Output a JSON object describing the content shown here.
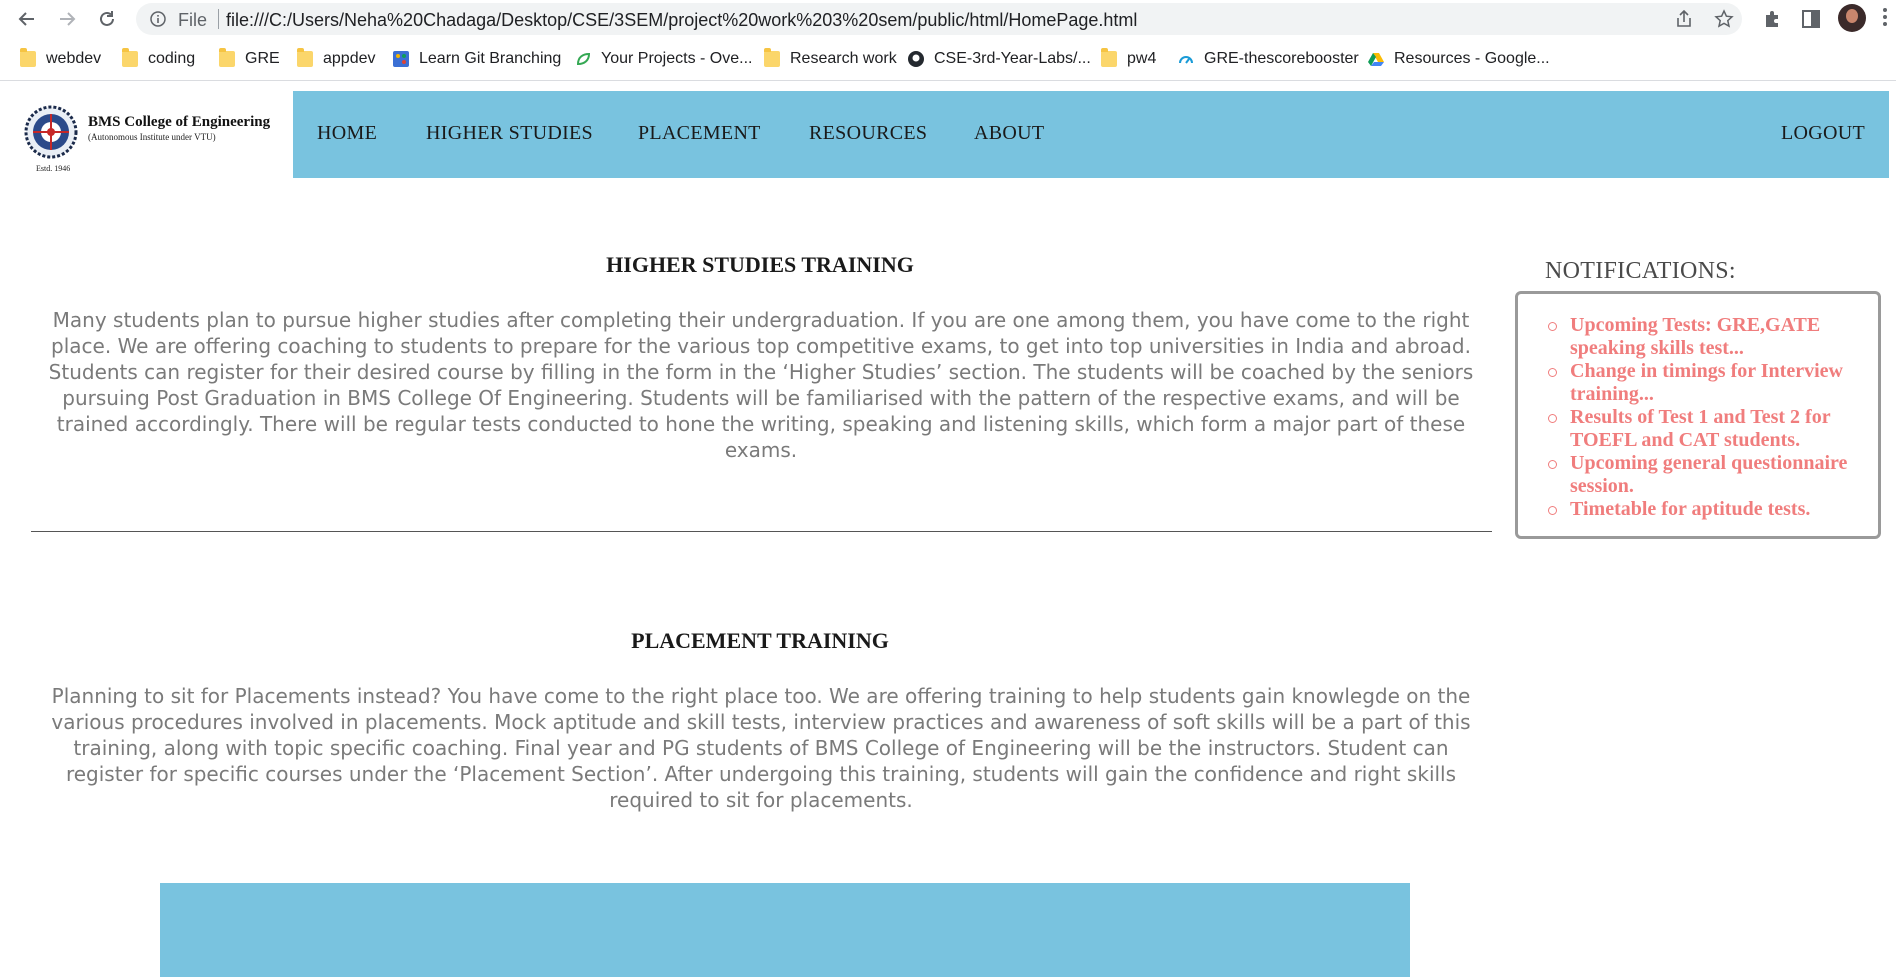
{
  "browser": {
    "scheme_label": "File",
    "url": "file:///C:/Users/Neha%20Chadaga/Desktop/CSE/3SEM/project%20work%203%20sem/public/html/HomePage.html",
    "bookmarks": [
      {
        "label": "webdev",
        "icon": "folder-icon"
      },
      {
        "label": "coding",
        "icon": "folder-icon"
      },
      {
        "label": "GRE",
        "icon": "folder-icon"
      },
      {
        "label": "appdev",
        "icon": "folder-icon"
      },
      {
        "label": "Learn Git Branching",
        "icon": "git-branching-icon"
      },
      {
        "label": "Your Projects - Ove...",
        "icon": "leaf-icon"
      },
      {
        "label": "Research work",
        "icon": "folder-icon"
      },
      {
        "label": "CSE-3rd-Year-Labs/...",
        "icon": "github-icon"
      },
      {
        "label": "pw4",
        "icon": "folder-icon"
      },
      {
        "label": "GRE-thescorebooster",
        "icon": "gauge-icon"
      },
      {
        "label": "Resources - Google...",
        "icon": "google-drive-icon"
      }
    ]
  },
  "header": {
    "logo_title": "BMS College of Engineering",
    "logo_subtitle": "(Autonomous Institute under VTU)",
    "logo_estd": "Estd. 1946",
    "nav": [
      "HOME",
      "HIGHER STUDIES",
      "PLACEMENT",
      "RESOURCES",
      "ABOUT"
    ],
    "logout": "LOGOUT"
  },
  "main": {
    "higher_studies": {
      "title": "HIGHER STUDIES TRAINING",
      "body": "Many students plan to pursue higher studies after completing their undergraduation. If you are one among them, you have come to the right place. We are offering coaching to students to prepare for the various top competitive exams, to get into top universities in India and abroad. Students can register for their desired course by filling in the form in the ‘Higher Studies’ section. The students will be coached by the seniors pursuing Post Graduation in BMS College Of Engineering. Students will be familiarised with the pattern of the respective exams, and will be trained accordingly. There will be regular tests conducted to hone the writing, speaking and listening skills, which form a major part of these exams."
    },
    "placement": {
      "title": "PLACEMENT TRAINING",
      "body": "Planning to sit for Placements instead? You have come to the right place too. We are offering training to help students gain knowlegde on the various procedures involved in placements. Mock aptitude and skill tests, interview practices and awareness of soft skills will be a part of this training, along with topic specific coaching. Final year and PG students of BMS College of Engineering will be the instructors. Student can register for specific courses under the ‘Placement Section’. After undergoing this training, students will gain the confidence and right skills required to sit for placements."
    }
  },
  "notifications": {
    "title": "NOTIFICATIONS:",
    "items": [
      "Upcoming Tests: GRE,GATE speaking skills test...",
      "Change in timings for Interview training...",
      "Results of Test 1 and Test 2 for TOEFL and CAT students.",
      "Upcoming general questionnaire session.",
      "Timetable for aptitude tests."
    ]
  },
  "colors": {
    "nav_bg": "#79c3df",
    "notification_text": "#f07d7d",
    "body_text": "#7a7a7a"
  }
}
